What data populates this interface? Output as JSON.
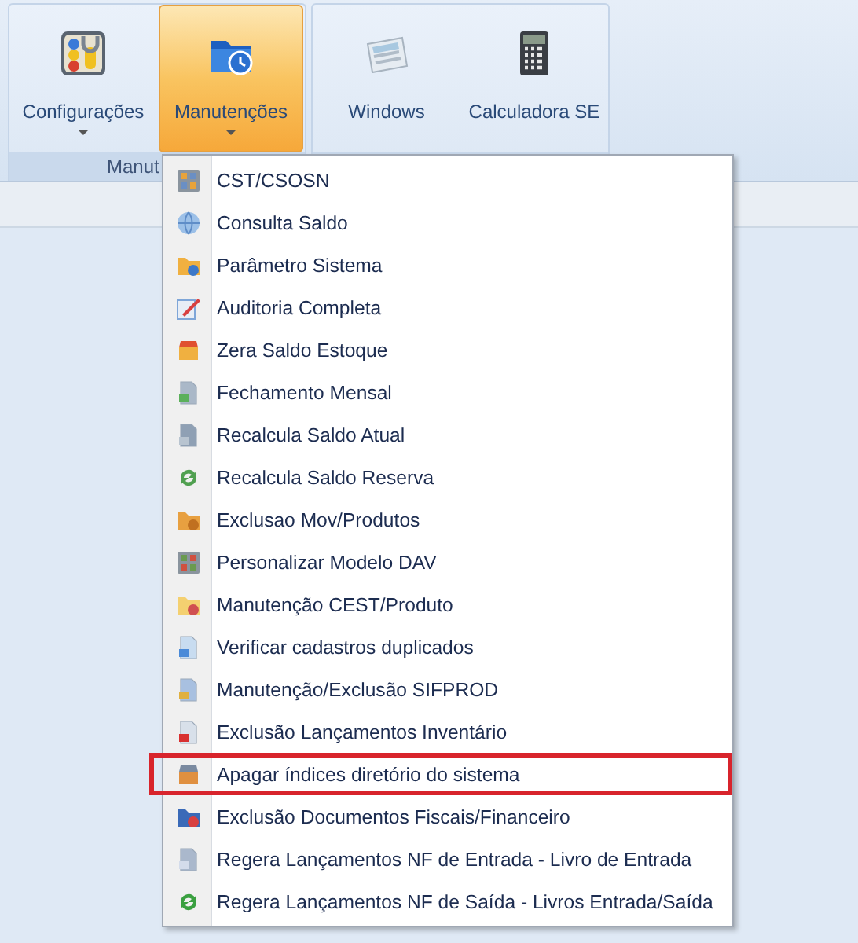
{
  "ribbon": {
    "groups": [
      {
        "label": "Manut",
        "buttons": [
          {
            "label": "Configurações",
            "dropdown": true,
            "selected": false
          },
          {
            "label": "Manutenções",
            "dropdown": true,
            "selected": true
          }
        ]
      },
      {
        "buttons": [
          {
            "label": "Windows",
            "dropdown": false,
            "selected": false
          },
          {
            "label": "Calculadora SE",
            "dropdown": false,
            "selected": false
          }
        ]
      }
    ]
  },
  "menu": {
    "items": [
      {
        "label": "CST/CSOSN",
        "highlighted": false
      },
      {
        "label": "Consulta Saldo",
        "highlighted": false
      },
      {
        "label": "Parâmetro Sistema",
        "highlighted": false
      },
      {
        "label": "Auditoria Completa",
        "highlighted": false
      },
      {
        "label": "Zera Saldo Estoque",
        "highlighted": false
      },
      {
        "label": "Fechamento Mensal",
        "highlighted": false
      },
      {
        "label": "Recalcula Saldo Atual",
        "highlighted": false
      },
      {
        "label": "Recalcula Saldo Reserva",
        "highlighted": false
      },
      {
        "label": "Exclusao Mov/Produtos",
        "highlighted": false
      },
      {
        "label": "Personalizar Modelo DAV",
        "highlighted": false
      },
      {
        "label": "Manutenção CEST/Produto",
        "highlighted": false
      },
      {
        "label": "Verificar cadastros duplicados",
        "highlighted": false
      },
      {
        "label": "Manutenção/Exclusão SIFPROD",
        "highlighted": false
      },
      {
        "label": "Exclusão Lançamentos Inventário",
        "highlighted": false
      },
      {
        "label": "Apagar índices diretório do sistema",
        "highlighted": true
      },
      {
        "label": "Exclusão Documentos Fiscais/Financeiro",
        "highlighted": false
      },
      {
        "label": "Regera Lançamentos NF de Entrada - Livro de Entrada",
        "highlighted": false
      },
      {
        "label": "Regera Lançamentos NF de Saída - Livros Entrada/Saída",
        "highlighted": false
      }
    ]
  }
}
